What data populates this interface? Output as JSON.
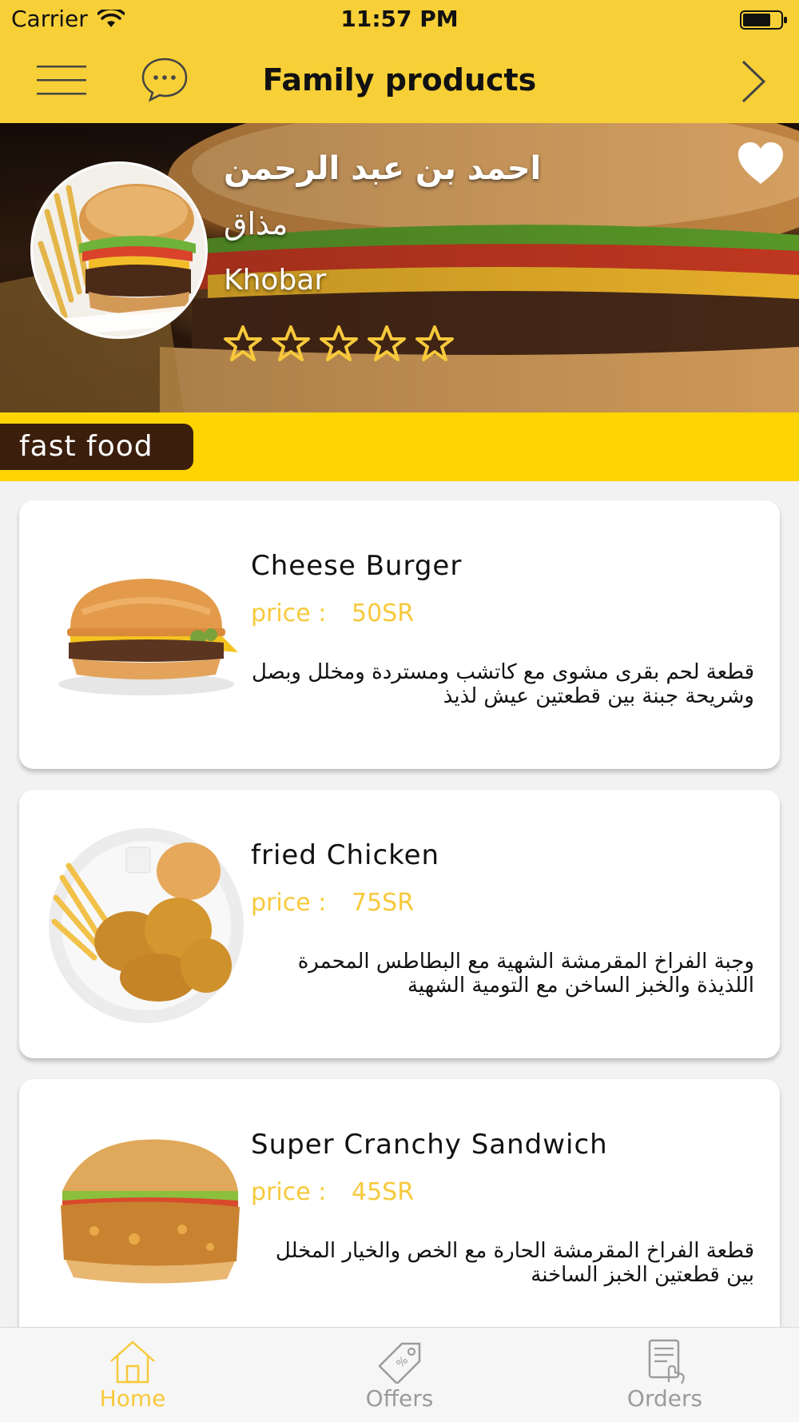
{
  "status_bar": {
    "carrier": "Carrier",
    "time": "11:57 PM"
  },
  "nav": {
    "title": "Family products",
    "icons": [
      "menu-icon",
      "chat-icon",
      "chevron-right-icon"
    ]
  },
  "store": {
    "name": "احمد بن عبد الرحمن",
    "subtitle": "مذاق",
    "city": "Khobar",
    "rating": 5,
    "rating_max": 5
  },
  "category": {
    "label": "fast food"
  },
  "products": [
    {
      "name": "Cheese Burger",
      "price_label": "price :",
      "price": "50SR",
      "description": "قطعة لحم بقرى مشوى مع كاتشب ومستردة ومخلل وبصل وشريحة جبنة بين قطعتين عيش لذيذ",
      "image_icon": "cheese-burger-image"
    },
    {
      "name": "fried Chicken",
      "price_label": "price :",
      "price": "75SR",
      "description": "وجبة الفراخ المقرمشة الشهية مع البطاطس المحمرة اللذيذة والخبز الساخن مع التومية الشهية",
      "image_icon": "fried-chicken-image"
    },
    {
      "name": "Super Cranchy Sandwich",
      "price_label": "price :",
      "price": "45SR",
      "description": "قطعة الفراخ المقرمشة الحارة مع الخص والخيار المخلل بين قطعتين الخبز الساخنة",
      "image_icon": "chicken-sandwich-image"
    }
  ],
  "tabs": [
    {
      "label": "Home",
      "icon": "home-icon",
      "active": true
    },
    {
      "label": "Offers",
      "icon": "tag-icon",
      "active": false
    },
    {
      "label": "Orders",
      "icon": "orders-list-icon",
      "active": false
    }
  ],
  "colors": {
    "header_yellow": "#f7cf37",
    "strip_yellow": "#fed403",
    "pill_brown": "#3b1e0c",
    "price_gold": "#f7c93b",
    "tab_active": "#f7c93b",
    "tab_inactive": "#9b9b9b"
  }
}
